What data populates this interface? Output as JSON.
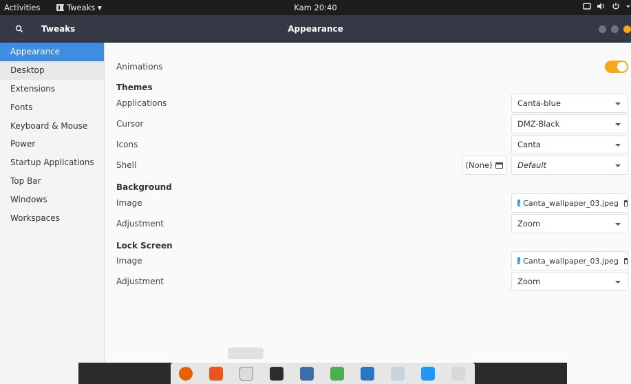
{
  "topbar": {
    "activities": "Activities",
    "app_name": "Tweaks ▾",
    "clock": "Kam 20:40",
    "tray_icons": [
      "screen-icon",
      "volume-icon",
      "power-icon"
    ]
  },
  "header": {
    "left_title": "Tweaks",
    "center_title": "Appearance"
  },
  "sidebar": {
    "items": [
      {
        "label": "Appearance"
      },
      {
        "label": "Desktop"
      },
      {
        "label": "Extensions"
      },
      {
        "label": "Fonts"
      },
      {
        "label": "Keyboard & Mouse"
      },
      {
        "label": "Power"
      },
      {
        "label": "Startup Applications"
      },
      {
        "label": "Top Bar"
      },
      {
        "label": "Windows"
      },
      {
        "label": "Workspaces"
      }
    ]
  },
  "main": {
    "animations_label": "Animations",
    "animations_on": true,
    "themes_heading": "Themes",
    "applications_label": "Applications",
    "applications_value": "Canta-blue",
    "cursor_label": "Cursor",
    "cursor_value": "DMZ-Black",
    "icons_label": "Icons",
    "icons_value": "Canta",
    "shell_label": "Shell",
    "shell_none": "(None)",
    "shell_value": "Default",
    "background_heading": "Background",
    "bg_image_label": "Image",
    "bg_image_value": "Canta_wallpaper_03.jpeg",
    "bg_adjust_label": "Adjustment",
    "bg_adjust_value": "Zoom",
    "lock_heading": "Lock Screen",
    "lock_image_label": "Image",
    "lock_image_value": "Canta_wallpaper_03.jpeg",
    "lock_adjust_label": "Adjustment",
    "lock_adjust_value": "Zoom"
  },
  "colors": {
    "accent": "#f8a61c",
    "selection": "#3d8ee0",
    "header": "#353945"
  },
  "dock": {
    "icons": [
      "firefox-icon",
      "software-icon",
      "tweaks-icon",
      "terminal-icon",
      "files-icon",
      "layers-icon",
      "writer-icon",
      "text-editor-icon",
      "wps-icon",
      "app-grid-icon"
    ]
  }
}
